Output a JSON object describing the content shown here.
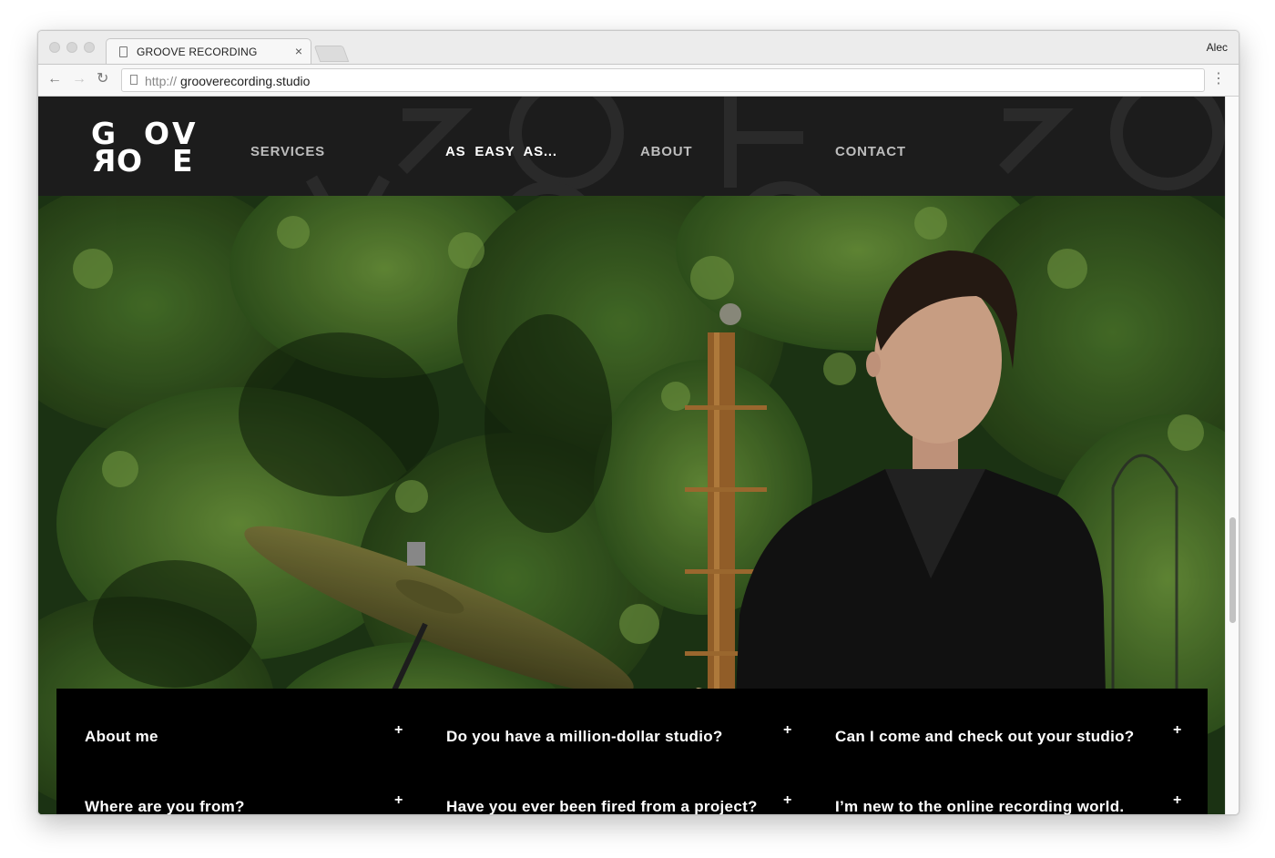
{
  "browser": {
    "tab_title": "GROOVE RECORDING",
    "tab_close": "×",
    "profile_name": "Alec",
    "url_protocol": "http://",
    "url_host": "grooverecording.studio",
    "back_icon": "←",
    "forward_icon": "→",
    "reload_icon": "↻",
    "menu_icon": "⋮"
  },
  "site": {
    "logo": {
      "row1": [
        "G",
        "O",
        "V"
      ],
      "row2": [
        "R",
        "O",
        "E"
      ]
    },
    "nav": [
      {
        "label": "SERVICES",
        "active": false
      },
      {
        "label": "AS  EASY  AS...",
        "active": true
      },
      {
        "label": "ABOUT",
        "active": false
      },
      {
        "label": "CONTACT",
        "active": false
      }
    ],
    "faq": [
      {
        "question": "About me",
        "icon": "+"
      },
      {
        "question": "Do you have a million-dollar studio?",
        "icon": "+"
      },
      {
        "question": "Can I come and check out your studio?",
        "icon": "+"
      },
      {
        "question": "Where are you from?",
        "icon": "+"
      },
      {
        "question": "Have you ever been fired from a project?",
        "icon": "+"
      },
      {
        "question": "I’m new to the online recording world.",
        "icon": "+"
      }
    ]
  },
  "colors": {
    "header_bg": "#1c1c1c",
    "panel_bg": "#000000",
    "nav_inactive": "#bdbdbd",
    "nav_active": "#ffffff"
  }
}
